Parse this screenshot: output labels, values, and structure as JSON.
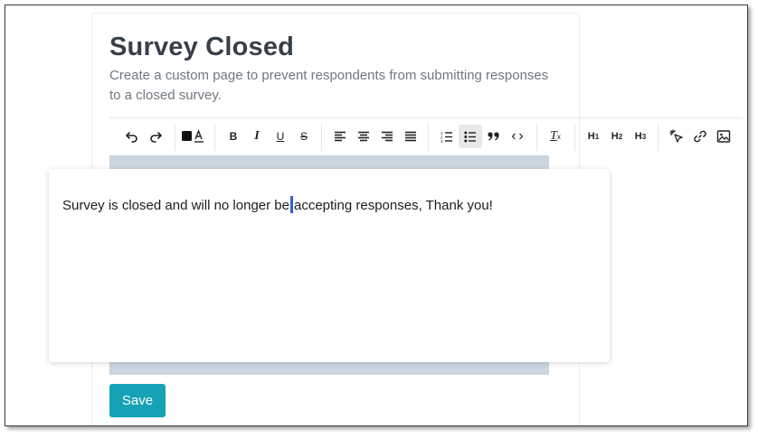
{
  "page": {
    "title": "Survey Closed",
    "description": "Create a custom page to prevent respondents from submitting responses to a closed survey."
  },
  "toolbar": {
    "groups": [
      [
        "undo-icon",
        "redo-icon"
      ],
      [
        "text-color-icon"
      ],
      [
        "bold-icon",
        "italic-icon",
        "underline-icon",
        "strikethrough-icon"
      ],
      [
        "align-left-icon",
        "align-center-icon",
        "align-right-icon",
        "align-justify-icon"
      ],
      [
        "ordered-list-icon",
        "bullet-list-icon",
        "blockquote-icon",
        "code-icon"
      ],
      [
        "clear-format-icon"
      ],
      [
        "heading-1-button",
        "heading-2-button",
        "heading-3-button"
      ],
      [
        "magic-pointer-icon",
        "link-icon",
        "image-icon"
      ]
    ],
    "h1_label": "H",
    "h1_sub": "1",
    "h2_label": "H",
    "h2_sub": "2",
    "h3_label": "H",
    "h3_sub": "3",
    "bold_label": "B",
    "italic_label": "I",
    "underline_label": "U",
    "strike_label": "S",
    "clear_label": "T",
    "clear_sub": "x",
    "text_color_swatch": "#111111",
    "active": [
      "bullet-list-icon"
    ]
  },
  "editor": {
    "text_before_caret": "Survey is closed and will no longer be",
    "text_after_caret": "accepting responses, Thank you!",
    "background_color": "#cbd5e0",
    "caret_color": "#2f5fd8"
  },
  "save_button": {
    "label": "Save",
    "color": "#14a2b4"
  }
}
